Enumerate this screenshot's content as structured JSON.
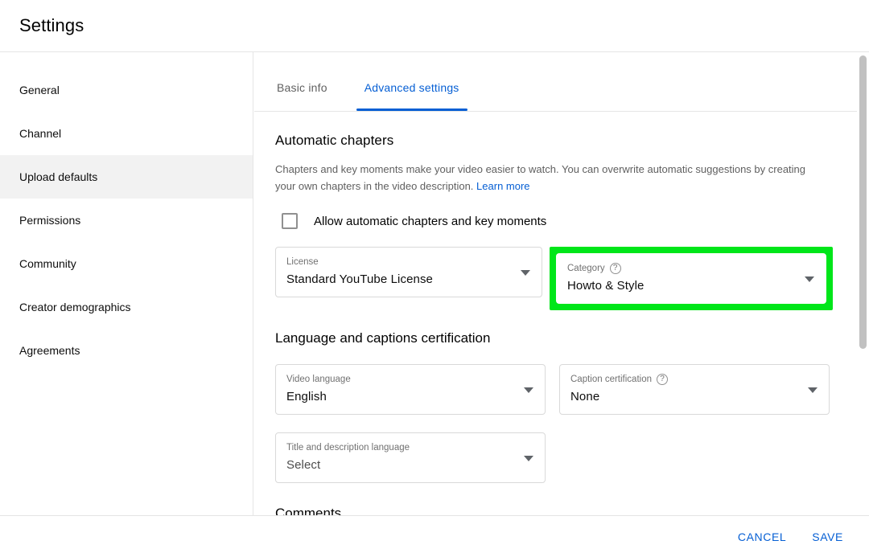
{
  "header": {
    "title": "Settings"
  },
  "sidebar": {
    "items": [
      {
        "label": "General",
        "active": false
      },
      {
        "label": "Channel",
        "active": false
      },
      {
        "label": "Upload defaults",
        "active": true
      },
      {
        "label": "Permissions",
        "active": false
      },
      {
        "label": "Community",
        "active": false
      },
      {
        "label": "Creator demographics",
        "active": false
      },
      {
        "label": "Agreements",
        "active": false
      }
    ]
  },
  "tabs": [
    {
      "label": "Basic info",
      "active": false
    },
    {
      "label": "Advanced settings",
      "active": true
    }
  ],
  "main": {
    "automatic_chapters": {
      "title": "Automatic chapters",
      "description": "Chapters and key moments make your video easier to watch. You can overwrite automatic suggestions by creating your own chapters in the video description.",
      "learn_more": "Learn more",
      "checkbox_label": "Allow automatic chapters and key moments",
      "checkbox_checked": false
    },
    "license_field": {
      "label": "License",
      "value": "Standard YouTube License"
    },
    "category_field": {
      "label": "Category",
      "value": "Howto & Style",
      "help_glyph": "?",
      "highlighted": true,
      "highlight_color": "#00e619"
    },
    "language_section": {
      "title": "Language and captions certification",
      "video_language_field": {
        "label": "Video language",
        "value": "English"
      },
      "caption_certification_field": {
        "label": "Caption certification",
        "value": "None",
        "help_glyph": "?"
      },
      "title_description_language_field": {
        "label": "Title and description language",
        "value": "Select"
      }
    },
    "comments_section": {
      "title": "Comments"
    }
  },
  "footer": {
    "cancel_label": "CANCEL",
    "save_label": "SAVE"
  },
  "colors": {
    "accent_blue": "#065fd4",
    "highlight_green": "#00e619",
    "active_row_gray": "#f2f2f2"
  }
}
